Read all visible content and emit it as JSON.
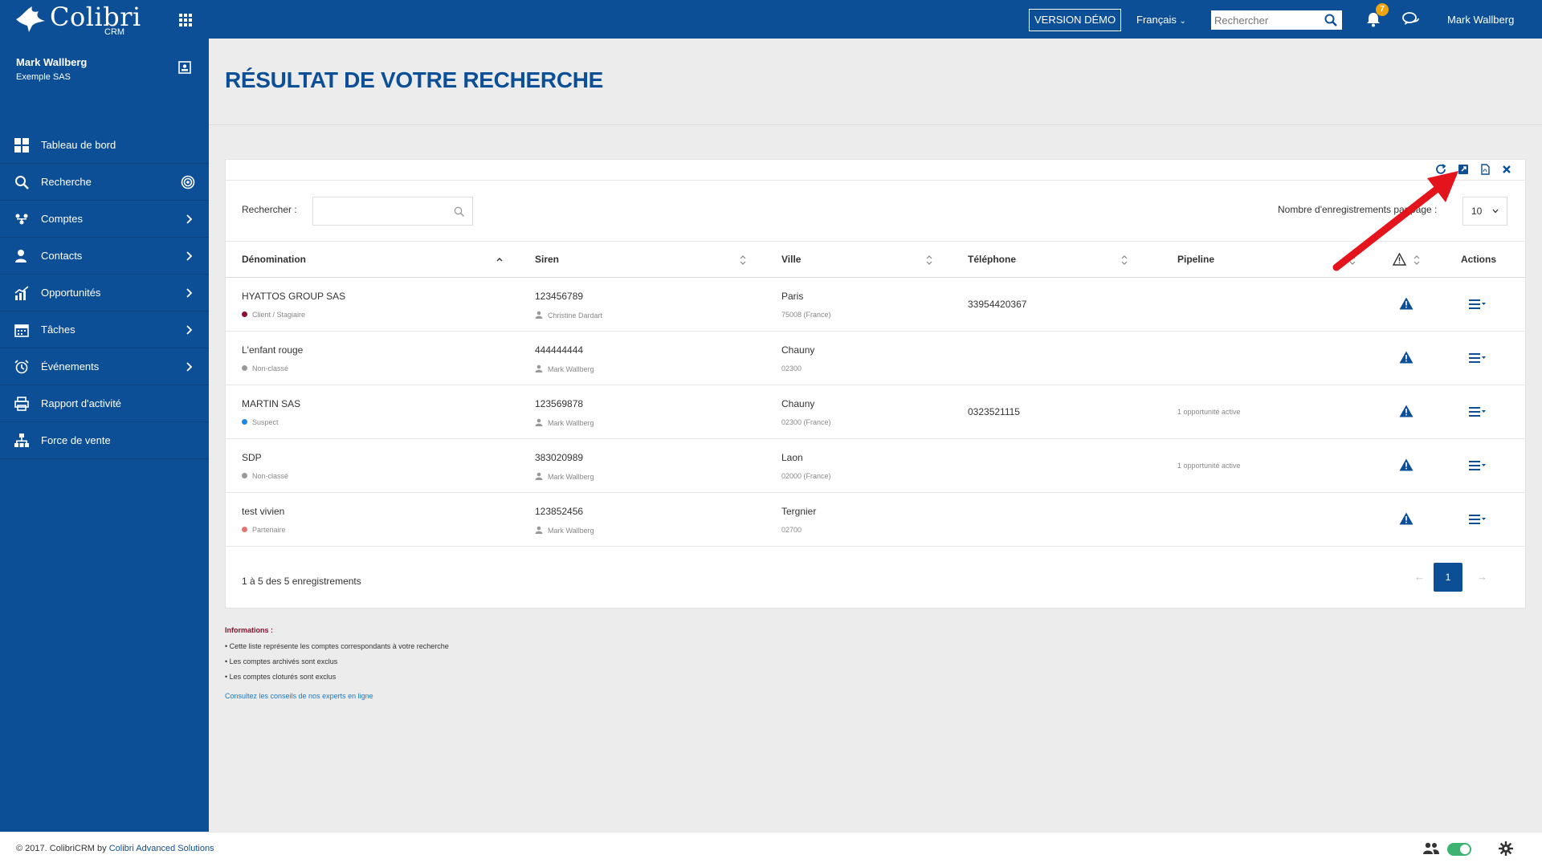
{
  "app": {
    "logo_text": "Colibri",
    "logo_sub": "CRM",
    "demo_label": "VERSION DÉMO",
    "language": "Français",
    "search_placeholder": "Rechercher",
    "notifications_count": "7",
    "user_name": "Mark Wallberg"
  },
  "sidebar": {
    "profile_name": "Mark Wallberg",
    "profile_company": "Exemple SAS",
    "items": [
      {
        "label": "Tableau de bord",
        "icon": "dashboard-icon",
        "has_chevron": false
      },
      {
        "label": "Recherche",
        "icon": "search-icon",
        "has_chevron": false
      },
      {
        "label": "Comptes",
        "icon": "accounts-icon",
        "has_chevron": true
      },
      {
        "label": "Contacts",
        "icon": "contacts-icon",
        "has_chevron": true
      },
      {
        "label": "Opportunités",
        "icon": "opportunities-icon",
        "has_chevron": true
      },
      {
        "label": "Tâches",
        "icon": "calendar-icon",
        "has_chevron": true
      },
      {
        "label": "Événements",
        "icon": "alarm-icon",
        "has_chevron": true
      },
      {
        "label": "Rapport d'activité",
        "icon": "printer-icon",
        "has_chevron": false
      },
      {
        "label": "Force de vente",
        "icon": "sitemap-icon",
        "has_chevron": false
      }
    ]
  },
  "page": {
    "title": "RÉSULTAT DE VOTRE RECHERCHE"
  },
  "panel": {
    "toolbar_icons": [
      "refresh-icon",
      "export-icon",
      "pdf-icon",
      "close-icon"
    ],
    "filter_label": "Rechercher :",
    "filter_value": "",
    "perpage_label": "Nombre d'enregistrements par page :",
    "perpage_value": "10",
    "columns": [
      "Dénomination",
      "Siren",
      "Ville",
      "Téléphone",
      "Pipeline",
      "",
      "Actions"
    ],
    "rows": [
      {
        "name": "HYATTOS GROUP SAS",
        "status": "Client / Stagiaire",
        "status_color": "#8b0f2f",
        "siren": "123456789",
        "owner": "Christine Dardart",
        "city": "Paris",
        "postal": "75008 (France)",
        "phone": "33954420367",
        "pipeline": ""
      },
      {
        "name": "L'enfant rouge",
        "status": "Non-classé",
        "status_color": "#999999",
        "siren": "444444444",
        "owner": "Mark Wallberg",
        "city": "Chauny",
        "postal": "02300",
        "phone": "",
        "pipeline": ""
      },
      {
        "name": "MARTIN SAS",
        "status": "Suspect",
        "status_color": "#1e88e5",
        "siren": "123569878",
        "owner": "Mark Wallberg",
        "city": "Chauny",
        "postal": "02300 (France)",
        "phone": "0323521115",
        "pipeline": "1 opportunité active"
      },
      {
        "name": "SDP",
        "status": "Non-classé",
        "status_color": "#999999",
        "siren": "383020989",
        "owner": "Mark Wallberg",
        "city": "Laon",
        "postal": "02000 (France)",
        "phone": "",
        "pipeline": "1 opportunité active"
      },
      {
        "name": "test vivien",
        "status": "Partenaire",
        "status_color": "#e57373",
        "siren": "123852456",
        "owner": "Mark Wallberg",
        "city": "Tergnier",
        "postal": "02700",
        "phone": "",
        "pipeline": ""
      }
    ],
    "summary": "1 à 5 des 5 enregistrements",
    "current_page": "1"
  },
  "info": {
    "title": "Informations :",
    "lines": [
      "• Cette liste représente les comptes correspondants à votre recherche",
      "• Les comptes archivés sont exclus",
      "• Les comptes cloturés sont exclus"
    ],
    "link": "Consultez les conseils de nos experts en ligne"
  },
  "footer": {
    "copyright_prefix": "© 2017. ColibriCRM by ",
    "copyright_brand": "Colibri Advanced Solutions"
  },
  "colors": {
    "primary": "#0d4f97",
    "accent_badge": "#f0a30a",
    "annotation": "#e3141b",
    "toggle_on": "#3cb371"
  }
}
